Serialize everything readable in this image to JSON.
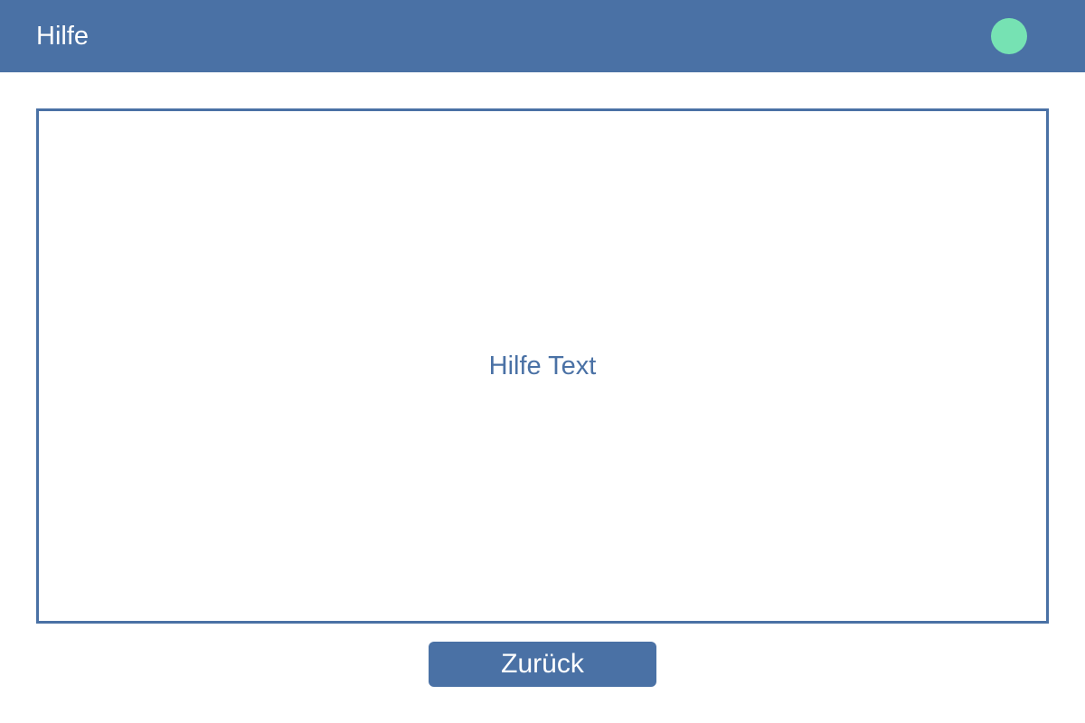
{
  "header": {
    "title": "Hilfe",
    "status_indicator": {
      "icon": "status-dot-icon",
      "color": "#76e2b3"
    }
  },
  "main": {
    "help_text": "Hilfe Text"
  },
  "actions": {
    "back_label": "Zurück"
  },
  "colors": {
    "primary": "#4a71a5",
    "background": "#ffffff",
    "header_text": "#ffffff"
  }
}
